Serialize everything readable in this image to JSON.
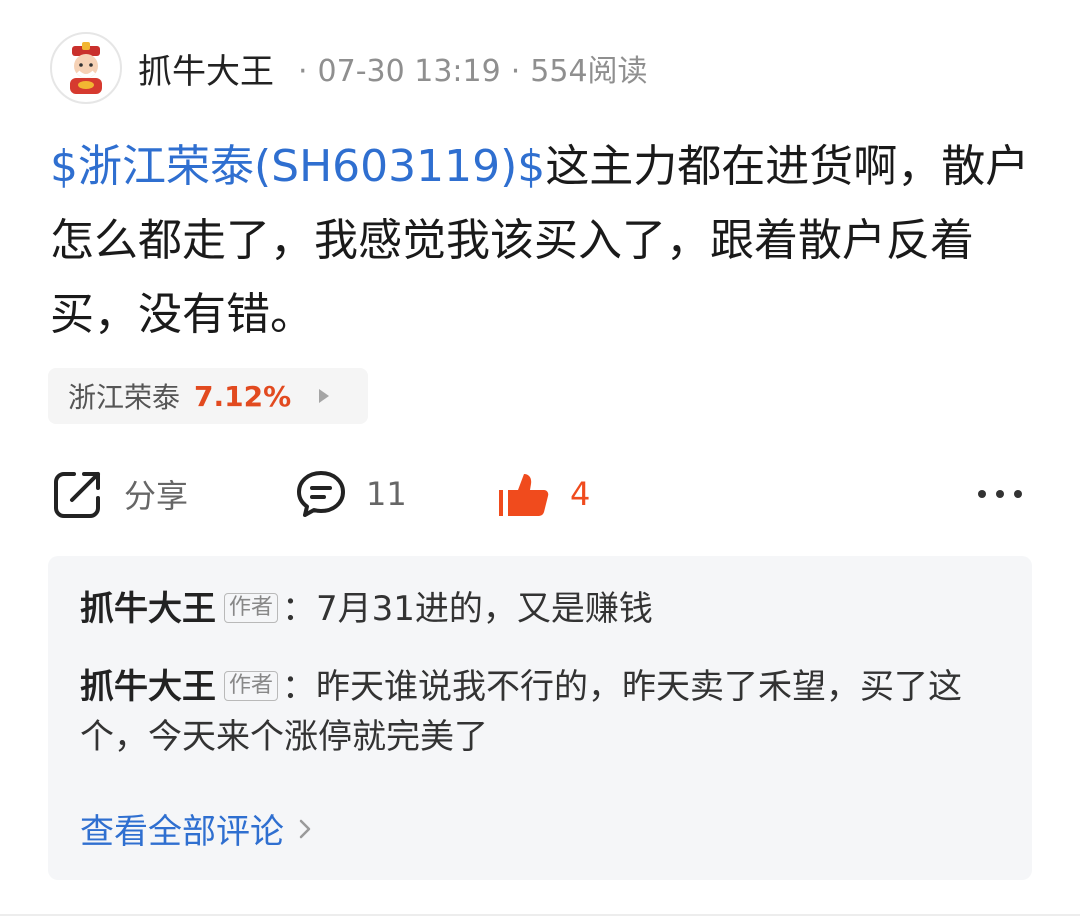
{
  "header": {
    "author": "抓牛大王",
    "separator": "·",
    "time": "07-30 13:19",
    "reads": "554阅读"
  },
  "post": {
    "stock_link": "$浙江荣泰(SH603119)$",
    "text": "这主力都在进货啊，散户怎么都走了，我感觉我该买入了，跟着散户反着买，没有错。"
  },
  "stock_chip": {
    "name": "浙江荣泰",
    "change": "7.12%"
  },
  "actions": {
    "share_label": "分享",
    "comment_count": "11",
    "like_count": "4"
  },
  "comments": [
    {
      "author": "抓牛大王",
      "badge": "作者",
      "colon": "：",
      "text": "7月31进的，又是赚钱"
    },
    {
      "author": "抓牛大王",
      "badge": "作者",
      "colon": "：",
      "text": "昨天谁说我不行的，昨天卖了禾望，买了这个，今天来个涨停就完美了"
    }
  ],
  "view_all_label": "查看全部评论",
  "colors": {
    "link_blue": "#2f6fd0",
    "up_red": "#e24a1f",
    "like_orange": "#f04b1d"
  }
}
